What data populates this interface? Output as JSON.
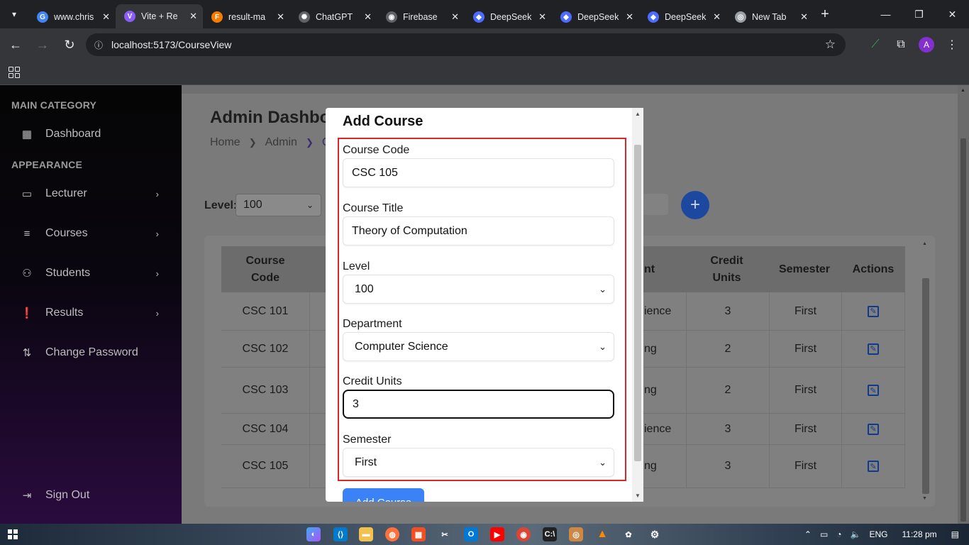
{
  "browser": {
    "tabs": [
      {
        "title": "www.chris",
        "color": "#4285f4",
        "glyph": "G",
        "active": false
      },
      {
        "title": "Vite + Re",
        "color": "#8b5cf6",
        "glyph": "V",
        "active": true
      },
      {
        "title": "result-ma",
        "color": "#f57c00",
        "glyph": "F",
        "active": false
      },
      {
        "title": "ChatGPT",
        "color": "#5f6368",
        "glyph": "✺",
        "active": false
      },
      {
        "title": "Firebase",
        "color": "#5f6368",
        "glyph": "◉",
        "active": false
      },
      {
        "title": "DeepSeek",
        "color": "#4d6bfe",
        "glyph": "◆",
        "active": false
      },
      {
        "title": "DeepSeek",
        "color": "#4d6bfe",
        "glyph": "◆",
        "active": false
      },
      {
        "title": "DeepSeek",
        "color": "#4d6bfe",
        "glyph": "◆",
        "active": false
      },
      {
        "title": "New Tab",
        "color": "#9aa0a6",
        "glyph": "◎",
        "active": false
      }
    ],
    "url": "localhost:5173/CourseView",
    "profile_initial": "A"
  },
  "sidebar": {
    "main_category": "MAIN CATEGORY",
    "dashboard": "Dashboard",
    "appearance": "APPEARANCE",
    "items": [
      {
        "label": "Lecturer"
      },
      {
        "label": "Courses"
      },
      {
        "label": "Students"
      },
      {
        "label": "Results"
      }
    ],
    "change_password": "Change Password",
    "sign_out": "Sign Out"
  },
  "page": {
    "title": "Admin Dashbo",
    "breadcrumb": [
      "Home",
      "Admin",
      "C"
    ],
    "level_label": "Level:",
    "level_value": "100"
  },
  "table": {
    "headers": {
      "code_line1": "Course",
      "code_line2": "Code",
      "dept_fragment": "nt",
      "credit_line1": "Credit",
      "credit_line2": "Units",
      "semester": "Semester",
      "actions": "Actions"
    },
    "rows": [
      {
        "code": "CSC 101",
        "dept": "ience",
        "credit": "3",
        "semester": "First"
      },
      {
        "code": "CSC 102",
        "dept": "ng",
        "credit": "2",
        "semester": "First"
      },
      {
        "code": "CSC 103",
        "dept": "ng",
        "credit": "2",
        "semester": "First"
      },
      {
        "code": "CSC 104",
        "dept": "ience",
        "credit": "3",
        "semester": "First"
      },
      {
        "code": "CSC 105",
        "dept": "ng",
        "credit": "3",
        "semester": "First"
      }
    ]
  },
  "modal": {
    "title": "Add Course",
    "course_code_label": "Course Code",
    "course_code_value": "CSC 105",
    "course_title_label": "Course Title",
    "course_title_value": "Theory of Computation",
    "level_label": "Level",
    "level_value": "100",
    "department_label": "Department",
    "department_value": "Computer Science",
    "credit_units_label": "Credit Units",
    "credit_units_value": "3",
    "semester_label": "Semester",
    "semester_value": "First",
    "submit_label": "Add Course"
  },
  "taskbar": {
    "language": "ENG",
    "time": "11:28 pm"
  },
  "colors": {
    "accent": "#3b82f6",
    "highlight": "#d42a2a",
    "add_button": "#1d48a0"
  }
}
